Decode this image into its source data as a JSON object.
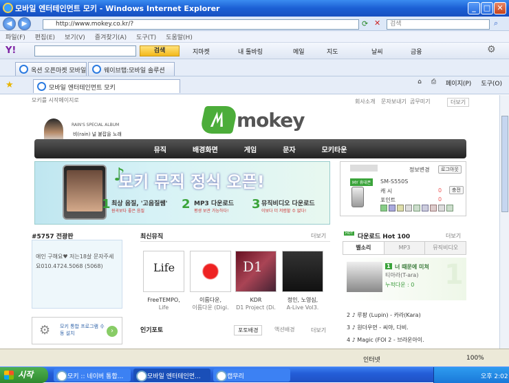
{
  "window": {
    "title": "모바일 엔터테인먼트 모키 - Windows Internet Explorer"
  },
  "address": {
    "url": "http://www.mokey.co.kr/?",
    "search_placeholder": "검색"
  },
  "menu": [
    "파일(F)",
    "편집(E)",
    "보기(V)",
    "즐겨찾기(A)",
    "도구(T)",
    "도움말(H)"
  ],
  "yahoo_toolbar": {
    "search_button": "검색",
    "items": [
      "지마켓",
      "내 툴바링",
      "메일",
      "지도",
      "날씨",
      "금융"
    ]
  },
  "tabs_row1": [
    "옥션 오픈마켓 모바일",
    "웨이브탭:모바일 솔루션"
  ],
  "tabs_row2": {
    "active": "모바일 엔터테인먼트 모키"
  },
  "commandbar": [
    "페이지(P)",
    "도구(O)"
  ],
  "site": {
    "top_left": "모키를 시작페이지로",
    "top_right": [
      "회사소개",
      "문자보내기",
      "곰무미기",
      "더보기"
    ],
    "logo": "mokey",
    "promo_title": "RAIN'S SPECIAL ALBUM",
    "promo_sub": "비(rain) 널 붙잡을 노래",
    "nav": [
      "뮤직",
      "배경화면",
      "게임",
      "문자",
      "모키타운"
    ],
    "banner": {
      "title": "모키 뮤직 정식 오픈!",
      "features": [
        {
          "num": "1",
          "label": "최상 음질, '고음질쌤'",
          "sub": "원곡보다 좋은 음질"
        },
        {
          "num": "2",
          "label": "MP3 다운로드",
          "sub": "평생 보관 가능하다!"
        },
        {
          "num": "3",
          "label": "뮤직비디오 다운로드",
          "sub": "이보다 더 저렴할 수 없다!"
        }
      ]
    },
    "login": {
      "info_change": "정보변경",
      "logout": "로그아웃",
      "phone": "SM-S550S",
      "my_phone": "MY 휴대폰",
      "cash_label": "캐 시",
      "cash_value": "0",
      "cash_btn": "충전",
      "point_label": "포인트",
      "point_value": "0"
    },
    "board": {
      "title": "#5757 전광판",
      "text": "애인 구해요♥ 저는18살 문자주세요010.4724.5068 (5068)"
    },
    "install": {
      "label": "모키 통합 프로그램 수동 설치"
    },
    "latest_music": {
      "title": "최신뮤직",
      "more": "더보기",
      "albums": [
        {
          "line1": "FreeTEMPO,",
          "line2": "Life"
        },
        {
          "line1": "이름다운,",
          "line2": "이름다운 (Digi."
        },
        {
          "line1": "KDR",
          "line2": "D1 Project (Di."
        },
        {
          "line1": "정인, 노영심,",
          "line2": "A-Live Vol3."
        }
      ]
    },
    "popular_photo": {
      "title": "인기포토",
      "tabs": [
        "포토배경",
        "액션배경"
      ],
      "more": "더보기"
    },
    "download_chart": {
      "title": "다운로드 Hot 100",
      "more": "더보기",
      "tabs": [
        "벨소리",
        "MP3",
        "뮤직비디오"
      ],
      "top": {
        "rank": "1",
        "song": "너 때문에 미쳐",
        "artist": "티아라(T-ara)",
        "count": "누적다운 : 0"
      },
      "rows": [
        {
          "rank": "2",
          "text": "루팡 (Lupin) - 카라(Kara)"
        },
        {
          "rank": "3",
          "text": "원더우먼 - 씨야, 다비."
        },
        {
          "rank": "4",
          "text": "Magic (FOI 2 - 브라운아이."
        }
      ]
    }
  },
  "status": {
    "zone": "인터넷",
    "zoom": "100%"
  },
  "taskbar": {
    "start": "시작",
    "tasks": [
      "모키 :: 네이버 통합...",
      "모바일 엔터테인먼...",
      "캡무리"
    ],
    "clock": "오후 2:02"
  }
}
